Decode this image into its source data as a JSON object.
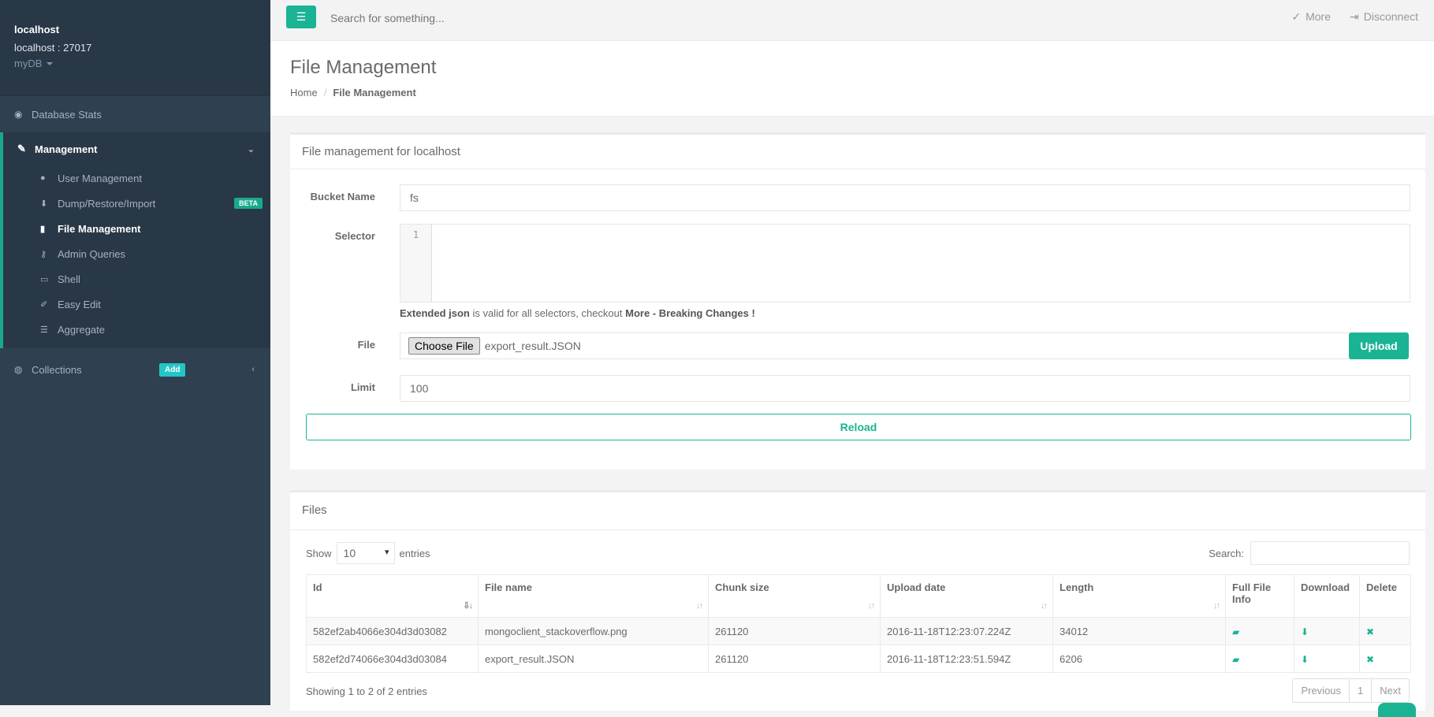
{
  "sidebar": {
    "host_title": "localhost",
    "host_port": "localhost : 27017",
    "db": "myDB",
    "database_stats": "Database Stats",
    "management": "Management",
    "items": [
      {
        "label": "User Management"
      },
      {
        "label": "Dump/Restore/Import",
        "badge": "BETA"
      },
      {
        "label": "File Management"
      },
      {
        "label": "Admin Queries"
      },
      {
        "label": "Shell"
      },
      {
        "label": "Easy Edit"
      },
      {
        "label": "Aggregate"
      }
    ],
    "collections": "Collections",
    "add_badge": "Add"
  },
  "topbar": {
    "search_placeholder": "Search for something...",
    "more": "More",
    "disconnect": "Disconnect"
  },
  "page": {
    "title": "File Management",
    "breadcrumb_home": "Home",
    "breadcrumb_current": "File Management"
  },
  "form": {
    "panel_title": "File management for localhost",
    "bucket_label": "Bucket Name",
    "bucket_value": "fs",
    "selector_label": "Selector",
    "line_number": "1",
    "hint_bold1": "Extended json",
    "hint_text": " is valid for all selectors, checkout ",
    "hint_bold2": "More - Breaking Changes !",
    "file_label": "File",
    "choose_file": "Choose File",
    "file_name": "export_result.JSON",
    "upload": "Upload",
    "limit_label": "Limit",
    "limit_value": "100",
    "reload": "Reload"
  },
  "files": {
    "panel_title": "Files",
    "show": "Show",
    "entries_select": "10",
    "entries": "entries",
    "search_label": "Search:",
    "columns": [
      "Id",
      "File name",
      "Chunk size",
      "Upload date",
      "Length",
      "Full File Info",
      "Download",
      "Delete"
    ],
    "rows": [
      {
        "id": "582ef2ab4066e304d3d03082",
        "name": "mongoclient_stackoverflow.png",
        "chunk": "261120",
        "date": "2016-11-18T12:23:07.224Z",
        "length": "34012"
      },
      {
        "id": "582ef2d74066e304d3d03084",
        "name": "export_result.JSON",
        "chunk": "261120",
        "date": "2016-11-18T12:23:51.594Z",
        "length": "6206"
      }
    ],
    "showing": "Showing 1 to 2 of 2 entries",
    "prev": "Previous",
    "page": "1",
    "next": "Next"
  },
  "colors": {
    "accent": "#1ab394",
    "sidebar": "#2f4050"
  }
}
